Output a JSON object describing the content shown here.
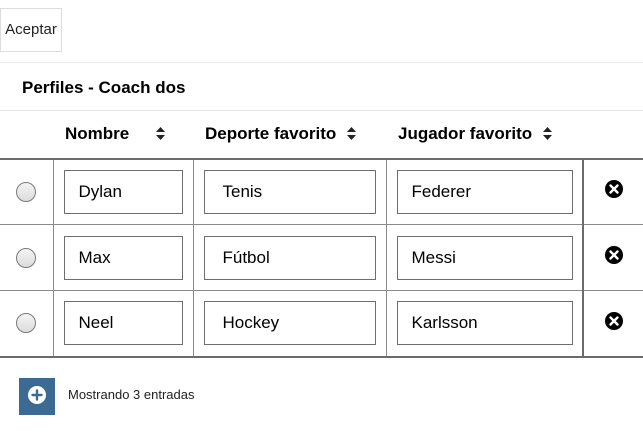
{
  "toolbar": {
    "accept_label": "Aceptar"
  },
  "panel": {
    "title": "Perfiles - Coach dos"
  },
  "table": {
    "columns": [
      "Nombre",
      "Deporte favorito",
      "Jugador favorito"
    ],
    "rows": [
      {
        "nombre": "Dylan",
        "deporte": "Tenis",
        "jugador": "Federer"
      },
      {
        "nombre": "Max",
        "deporte": "Fútbol",
        "jugador": "Messi"
      },
      {
        "nombre": "Neel",
        "deporte": "Hockey",
        "jugador": "Karlsson"
      }
    ]
  },
  "footer": {
    "entries_text": "Mostrando 3 entradas"
  },
  "icons": {
    "sort": "sort-arrows-icon",
    "delete": "times-circle-icon",
    "add": "plus-circle-icon"
  },
  "colors": {
    "add_button": "#3c6a93"
  }
}
